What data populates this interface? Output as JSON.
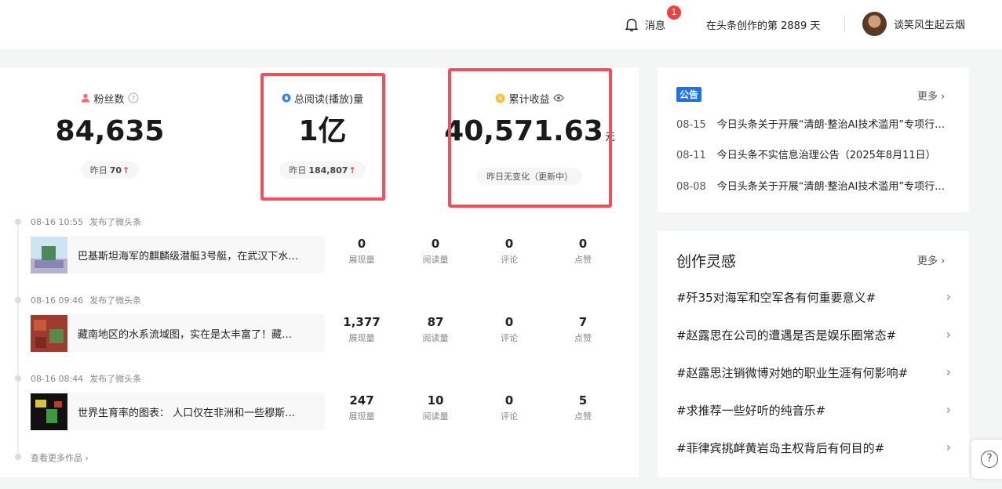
{
  "header": {
    "messages_label": "消息",
    "messages_badge": "1",
    "days_text": "在头条创作的第 2889 天",
    "username": "谈笑风生起云烟"
  },
  "stats": [
    {
      "label": "粉丝数",
      "icon": "fans-icon",
      "value": "84,635",
      "unit": "",
      "pill_prefix": "昨日",
      "pill_value": "70",
      "trend": "↑"
    },
    {
      "label": "总阅读(播放)量",
      "icon": "read-icon",
      "value": "1亿",
      "unit": "",
      "pill_prefix": "昨日",
      "pill_value": "184,807",
      "trend": "↑"
    },
    {
      "label": "累计收益",
      "icon": "income-icon",
      "value": "40,571.63",
      "unit": "元",
      "pill_text": "昨日无变化（更新中）"
    }
  ],
  "posts": [
    {
      "time": "08-16 10:55",
      "action": "发布了微头条",
      "title": "巴基斯坦海军的麒麟级潜艇3号艇，在武汉下水…",
      "metrics": [
        {
          "value": "0",
          "label": "展现量"
        },
        {
          "value": "0",
          "label": "阅读量"
        },
        {
          "value": "0",
          "label": "评论"
        },
        {
          "value": "0",
          "label": "点赞"
        }
      ]
    },
    {
      "time": "08-16 09:46",
      "action": "发布了微头条",
      "title": "藏南地区的水系流域图，实在是太丰富了！藏…",
      "metrics": [
        {
          "value": "1,377",
          "label": "展现量"
        },
        {
          "value": "87",
          "label": "阅读量"
        },
        {
          "value": "0",
          "label": "评论"
        },
        {
          "value": "7",
          "label": "点赞"
        }
      ]
    },
    {
      "time": "08-16 08:44",
      "action": "发布了微头条",
      "title": "世界生育率的图表： 人口仅在非洲和一些穆斯…",
      "metrics": [
        {
          "value": "247",
          "label": "展现量"
        },
        {
          "value": "10",
          "label": "阅读量"
        },
        {
          "value": "0",
          "label": "评论"
        },
        {
          "value": "5",
          "label": "点赞"
        }
      ]
    }
  ],
  "more_works": "查看更多作品",
  "notice": {
    "tag": "公告",
    "more": "更多",
    "items": [
      {
        "date": "08-15",
        "text": "今日头条关于开展“清朗·整治AI技术滥用”专项行动的公告"
      },
      {
        "date": "08-11",
        "text": "今日头条不实信息治理公告（2025年8月11日）"
      },
      {
        "date": "08-08",
        "text": "今日头条关于开展“清朗·整治AI技术滥用”专项行动的公告"
      }
    ]
  },
  "inspiration": {
    "title": "创作灵感",
    "more": "更多",
    "items": [
      "#歼35对海军和空军各有何重要意义#",
      "#赵露思在公司的遭遇是否是娱乐圈常态#",
      "#赵露思注销微博对她的职业生涯有何影响#",
      "#求推荐一些好听的纯音乐#",
      "#菲律宾挑衅黄岩岛主权背后有何目的#"
    ]
  },
  "colors": {
    "accent_red": "#f04142",
    "highlight_box": "#f0505e",
    "notice_tag": "#1a73e8"
  }
}
